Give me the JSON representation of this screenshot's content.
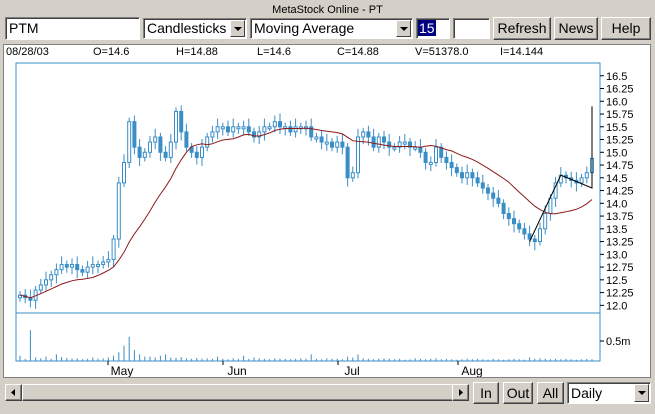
{
  "window": {
    "title": "MetaStock Online - PT"
  },
  "toolbar": {
    "symbol": "PTM",
    "chart_type": "Candlesticks",
    "indicator": "Moving Average",
    "period": "15",
    "extra": "",
    "refresh_label": "Refresh",
    "news_label": "News",
    "help_label": "Help"
  },
  "quote": {
    "date": "08/28/03",
    "open": "O=14.6",
    "high": "H=14.88",
    "low": "L=14.6",
    "close": "C=14.88",
    "volume": "V=51378.0",
    "indicator": "I=14.144"
  },
  "bottom": {
    "in_label": "In",
    "out_label": "Out",
    "all_label": "All",
    "interval": "Daily"
  },
  "colors": {
    "candle": "#3a8ec6",
    "ma": "#8b1a1a",
    "axis": "#3a8ec6",
    "trend": "#000000"
  },
  "chart_data": {
    "type": "candlestick",
    "title": "",
    "y_ticks": [
      "16.5",
      "16.25",
      "16.0",
      "15.75",
      "15.5",
      "15.25",
      "15.0",
      "14.75",
      "14.5",
      "14.25",
      "14.0",
      "13.75",
      "13.5",
      "13.25",
      "13.0",
      "12.75",
      "12.5",
      "12.25",
      "12.0"
    ],
    "ylim": [
      11.85,
      16.75
    ],
    "volume_tick": "0.5m",
    "x_ticks": [
      "May",
      "Jun",
      "Jul",
      "Aug"
    ],
    "ma_period": 15,
    "close": [
      12.2,
      12.15,
      12.1,
      12.3,
      12.4,
      12.5,
      12.6,
      12.7,
      12.8,
      12.75,
      12.8,
      12.7,
      12.65,
      12.75,
      12.8,
      12.8,
      12.85,
      12.9,
      13.3,
      14.4,
      14.8,
      15.6,
      15.1,
      14.9,
      15.0,
      15.2,
      15.3,
      15.0,
      14.9,
      15.2,
      15.8,
      15.4,
      15.1,
      15.0,
      14.9,
      15.1,
      15.3,
      15.4,
      15.5,
      15.5,
      15.4,
      15.5,
      15.5,
      15.5,
      15.4,
      15.3,
      15.4,
      15.5,
      15.5,
      15.6,
      15.5,
      15.5,
      15.4,
      15.5,
      15.5,
      15.5,
      15.3,
      15.3,
      15.2,
      15.2,
      15.1,
      15.2,
      15.1,
      14.5,
      14.6,
      15.3,
      15.4,
      15.3,
      15.1,
      15.3,
      15.2,
      15.1,
      15.1,
      15.2,
      15.2,
      15.1,
      15.1,
      15.0,
      14.8,
      14.8,
      15.1,
      14.9,
      14.8,
      14.7,
      14.6,
      14.5,
      14.6,
      14.5,
      14.4,
      14.3,
      14.2,
      14.1,
      14.0,
      13.8,
      13.7,
      13.6,
      13.5,
      13.4,
      13.3,
      13.25,
      13.5,
      13.8,
      14.1,
      14.4,
      14.55,
      14.5,
      14.45,
      14.4,
      14.5,
      14.6,
      14.88
    ],
    "volume": [
      0.12,
      0.05,
      0.7,
      0.08,
      0.06,
      0.1,
      0.05,
      0.15,
      0.09,
      0.07,
      0.05,
      0.06,
      0.04,
      0.05,
      0.08,
      0.05,
      0.06,
      0.08,
      0.12,
      0.2,
      0.35,
      0.55,
      0.25,
      0.15,
      0.1,
      0.1,
      0.08,
      0.12,
      0.15,
      0.08,
      0.07,
      0.09,
      0.06,
      0.05,
      0.07,
      0.05,
      0.06,
      0.05,
      0.1,
      0.05,
      0.04,
      0.06,
      0.05,
      0.12,
      0.05,
      0.08,
      0.06,
      0.05,
      0.04,
      0.06,
      0.05,
      0.05,
      0.04,
      0.05,
      0.06,
      0.05,
      0.15,
      0.05,
      0.04,
      0.06,
      0.05,
      0.05,
      0.04,
      0.1,
      0.08,
      0.15,
      0.06,
      0.05,
      0.04,
      0.05,
      0.06,
      0.05,
      0.04,
      0.05,
      0.03,
      0.04,
      0.06,
      0.05,
      0.04,
      0.05,
      0.06,
      0.04,
      0.05,
      0.04,
      0.03,
      0.04,
      0.05,
      0.04,
      0.05,
      0.04,
      0.03,
      0.05,
      0.04,
      0.03,
      0.04,
      0.05,
      0.04,
      0.03,
      0.08,
      0.05,
      0.06,
      0.05,
      0.04,
      0.05,
      0.04,
      0.05,
      0.04,
      0.03,
      0.04,
      0.05,
      0.04
    ],
    "trendline": [
      [
        98,
        13.25
      ],
      [
        104,
        14.55
      ],
      [
        110,
        14.3
      ],
      [
        114,
        15.9
      ]
    ]
  }
}
